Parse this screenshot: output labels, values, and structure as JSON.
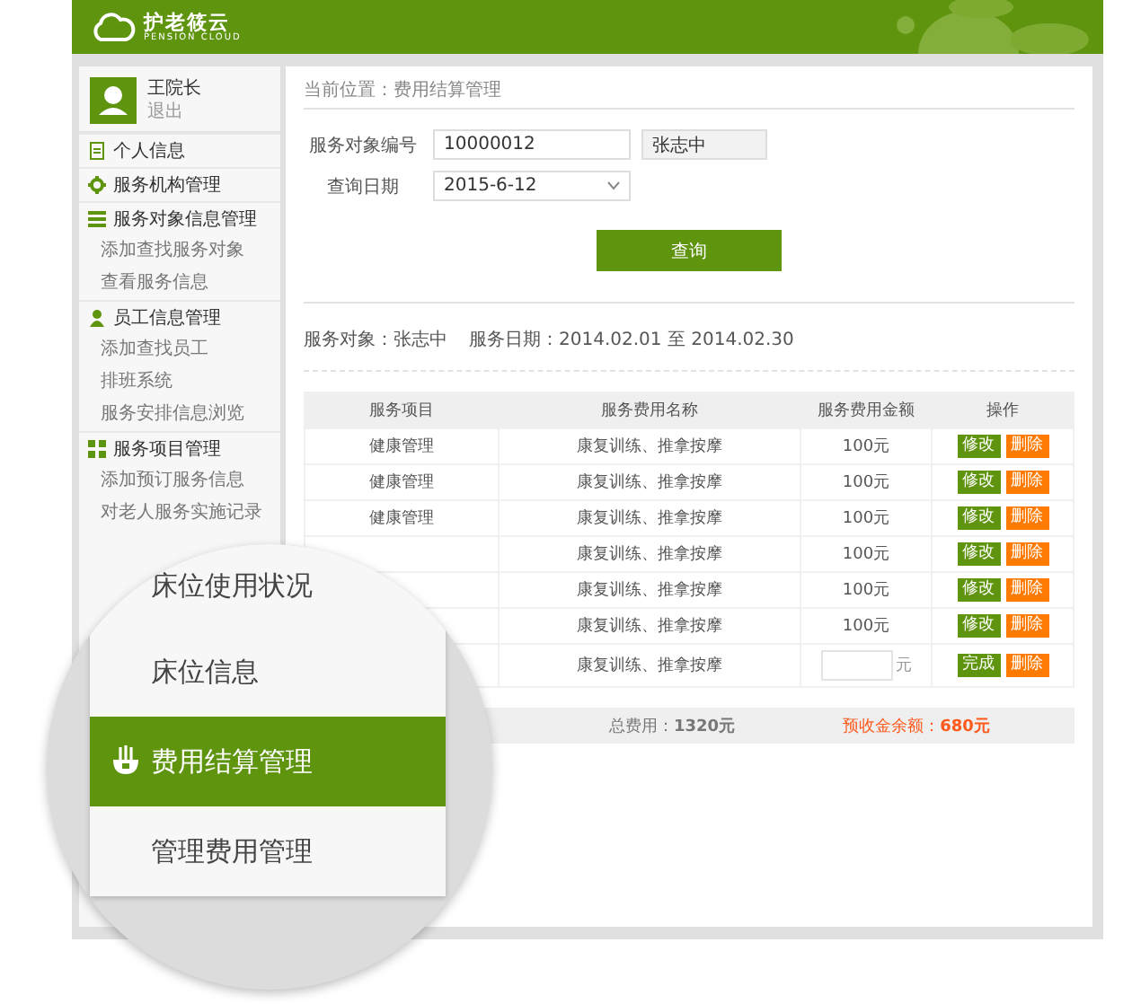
{
  "header": {
    "logo_title": "护老筱云",
    "logo_subtitle": "PENSION CLOUD"
  },
  "user": {
    "name": "王院长",
    "action": "退出"
  },
  "sidebar": {
    "groups": [
      {
        "label": "个人信息"
      },
      {
        "label": "服务机构管理"
      },
      {
        "label": "服务对象信息管理",
        "children": [
          {
            "label": "添加查找服务对象"
          },
          {
            "label": "查看服务信息"
          }
        ]
      },
      {
        "label": "员工信息管理",
        "children": [
          {
            "label": "添加查找员工"
          },
          {
            "label": "排班系统"
          },
          {
            "label": "服务安排信息浏览"
          }
        ]
      },
      {
        "label": "服务项目管理",
        "children": [
          {
            "label": "添加预订服务信息"
          },
          {
            "label": "对老人服务实施记录"
          }
        ]
      }
    ]
  },
  "breadcrumb": "当前位置：费用结算管理",
  "form": {
    "fields": [
      {
        "kind": "text",
        "label": "服务对象编号",
        "value": "10000012"
      },
      {
        "kind": "select",
        "label": "查询日期",
        "value": "2015-6-12"
      }
    ],
    "name_display": "张志中",
    "button": "查询"
  },
  "summary": [
    "服务对象：张志中",
    "服务日期：2014.02.01 至 2014.02.30"
  ],
  "table": {
    "columns": [
      "服务项目",
      "服务费用名称",
      "服务费用金额",
      "操作"
    ],
    "rows": [
      {
        "kind": "fixed",
        "item": "健康管理",
        "name": "康复训练、推拿按摩",
        "amount": "100元",
        "actions": [
          {
            "kind": "edit",
            "label": "修改"
          },
          {
            "kind": "delete",
            "label": "删除"
          }
        ]
      },
      {
        "kind": "fixed",
        "item": "健康管理",
        "name": "康复训练、推拿按摩",
        "amount": "100元",
        "actions": [
          {
            "kind": "edit",
            "label": "修改"
          },
          {
            "kind": "delete",
            "label": "删除"
          }
        ]
      },
      {
        "kind": "fixed",
        "item": "健康管理",
        "name": "康复训练、推拿按摩",
        "amount": "100元",
        "actions": [
          {
            "kind": "edit",
            "label": "修改"
          },
          {
            "kind": "delete",
            "label": "删除"
          }
        ]
      },
      {
        "kind": "fixed",
        "name": "康复训练、推拿按摩",
        "amount": "100元",
        "actions": [
          {
            "kind": "edit",
            "label": "修改"
          },
          {
            "kind": "delete",
            "label": "删除"
          }
        ]
      },
      {
        "kind": "fixed",
        "name": "康复训练、推拿按摩",
        "amount": "100元",
        "actions": [
          {
            "kind": "edit",
            "label": "修改"
          },
          {
            "kind": "delete",
            "label": "删除"
          }
        ]
      },
      {
        "kind": "fixed",
        "name": "康复训练、推拿按摩",
        "amount": "100元",
        "actions": [
          {
            "kind": "edit",
            "label": "修改"
          },
          {
            "kind": "delete",
            "label": "删除"
          }
        ]
      },
      {
        "kind": "editing",
        "name": "康复训练、推拿按摩",
        "unit": "元",
        "actions": [
          {
            "kind": "done",
            "label": "完成"
          },
          {
            "kind": "delete",
            "label": "删除"
          }
        ]
      }
    ],
    "footer": {
      "total": "总费用：**1320元**",
      "balance": "预收金余额：**680元**"
    }
  },
  "magnifier": {
    "items": [
      {
        "label": "床位使用状况",
        "selected": false
      },
      {
        "label": "床位信息",
        "selected": false
      },
      {
        "label": "费用结算管理",
        "selected": true
      },
      {
        "label": "管理费用管理",
        "selected": false
      }
    ]
  }
}
